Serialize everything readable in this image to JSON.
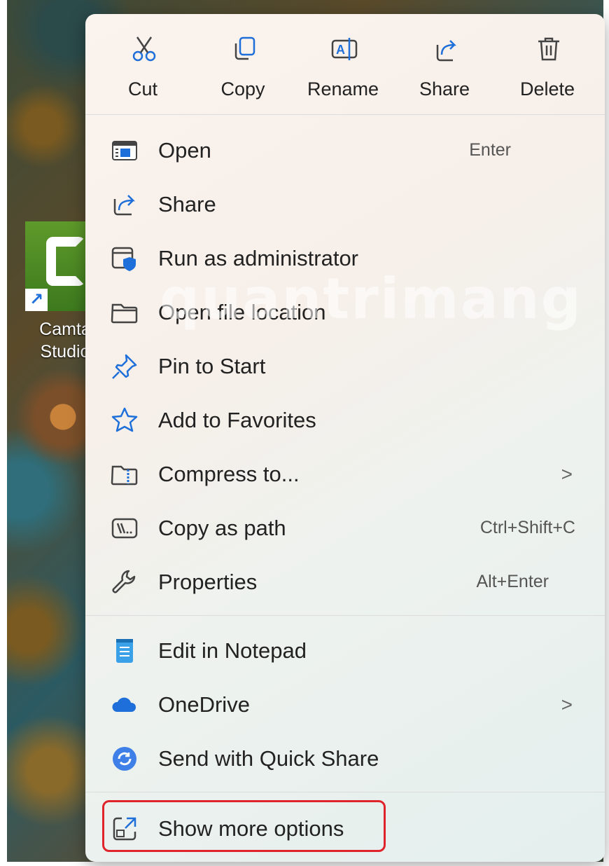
{
  "desktop": {
    "shortcut_label": "Camta\nStudio"
  },
  "toolbar": [
    {
      "label": "Cut",
      "icon": "scissors-icon"
    },
    {
      "label": "Copy",
      "icon": "copy-icon"
    },
    {
      "label": "Rename",
      "icon": "rename-icon"
    },
    {
      "label": "Share",
      "icon": "share-icon"
    },
    {
      "label": "Delete",
      "icon": "trash-icon"
    }
  ],
  "menu": {
    "items": [
      {
        "label": "Open",
        "shortcut": "Enter",
        "icon": "open-window-icon"
      },
      {
        "label": "Share",
        "shortcut": "",
        "icon": "share-icon"
      },
      {
        "label": "Run as administrator",
        "shortcut": "",
        "icon": "shield-window-icon"
      },
      {
        "label": "Open file location",
        "shortcut": "",
        "icon": "folder-icon"
      },
      {
        "label": "Pin to Start",
        "shortcut": "",
        "icon": "pin-icon"
      },
      {
        "label": "Add to Favorites",
        "shortcut": "",
        "icon": "star-icon"
      },
      {
        "label": "Compress to...",
        "shortcut": "",
        "submenu": ">",
        "icon": "zip-folder-icon"
      },
      {
        "label": "Copy as path",
        "shortcut": "Ctrl+Shift+C",
        "icon": "path-icon"
      },
      {
        "label": "Properties",
        "shortcut": "Alt+Enter",
        "icon": "wrench-icon"
      },
      {
        "label": "Edit in Notepad",
        "shortcut": "",
        "icon": "notepad-icon"
      },
      {
        "label": "OneDrive",
        "shortcut": "",
        "submenu": ">",
        "icon": "cloud-icon"
      },
      {
        "label": "Send with Quick Share",
        "shortcut": "",
        "icon": "quick-share-icon"
      },
      {
        "label": "Show more options",
        "shortcut": "",
        "icon": "external-icon"
      }
    ]
  },
  "watermark": "quantrimang",
  "colors": {
    "accent": "#1e6fd9",
    "highlight": "#e0242c"
  }
}
